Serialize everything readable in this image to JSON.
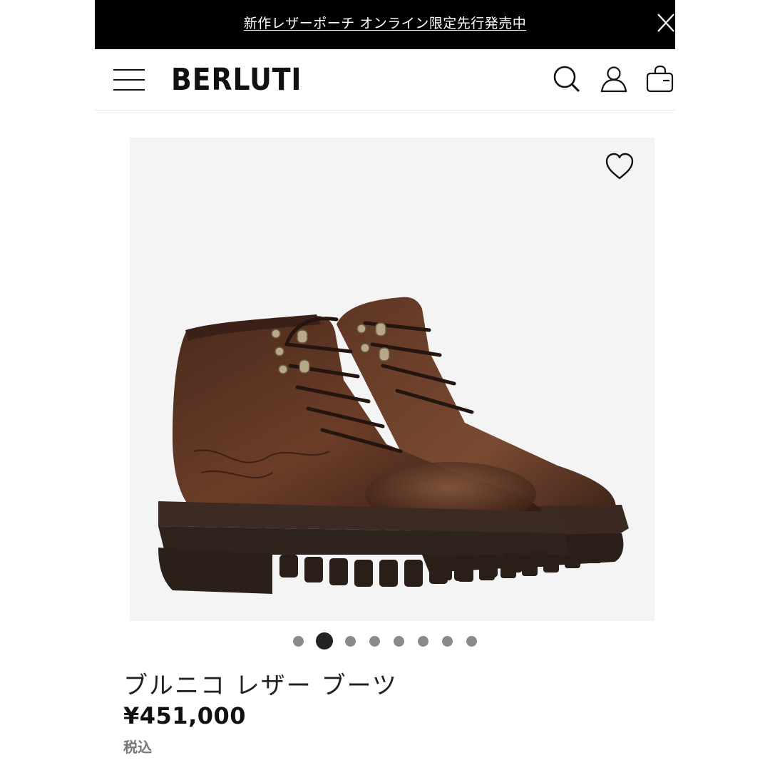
{
  "promo": {
    "text": "新作レザーポーチ オンライン限定先行発売中",
    "close_icon": "close-icon"
  },
  "header": {
    "logo": "BERLUTI",
    "menu_icon": "hamburger-menu-icon",
    "search_icon": "search-icon",
    "account_icon": "user-icon",
    "bag_icon": "shopping-bag-icon"
  },
  "product": {
    "wishlist_icon": "heart-icon",
    "image_description_icon": "boot-image",
    "carousel": {
      "count": 8,
      "active_index": 1
    },
    "title": "ブルニコ レザー ブーツ",
    "price": "¥451,000",
    "tax_note": "税込"
  },
  "colors": {
    "promo_bg": "#000000",
    "text": "#222222",
    "image_bg": "#f4f4f4",
    "dot": "#8a8a8a",
    "dot_active": "#222222",
    "leather": "#5a3424"
  }
}
